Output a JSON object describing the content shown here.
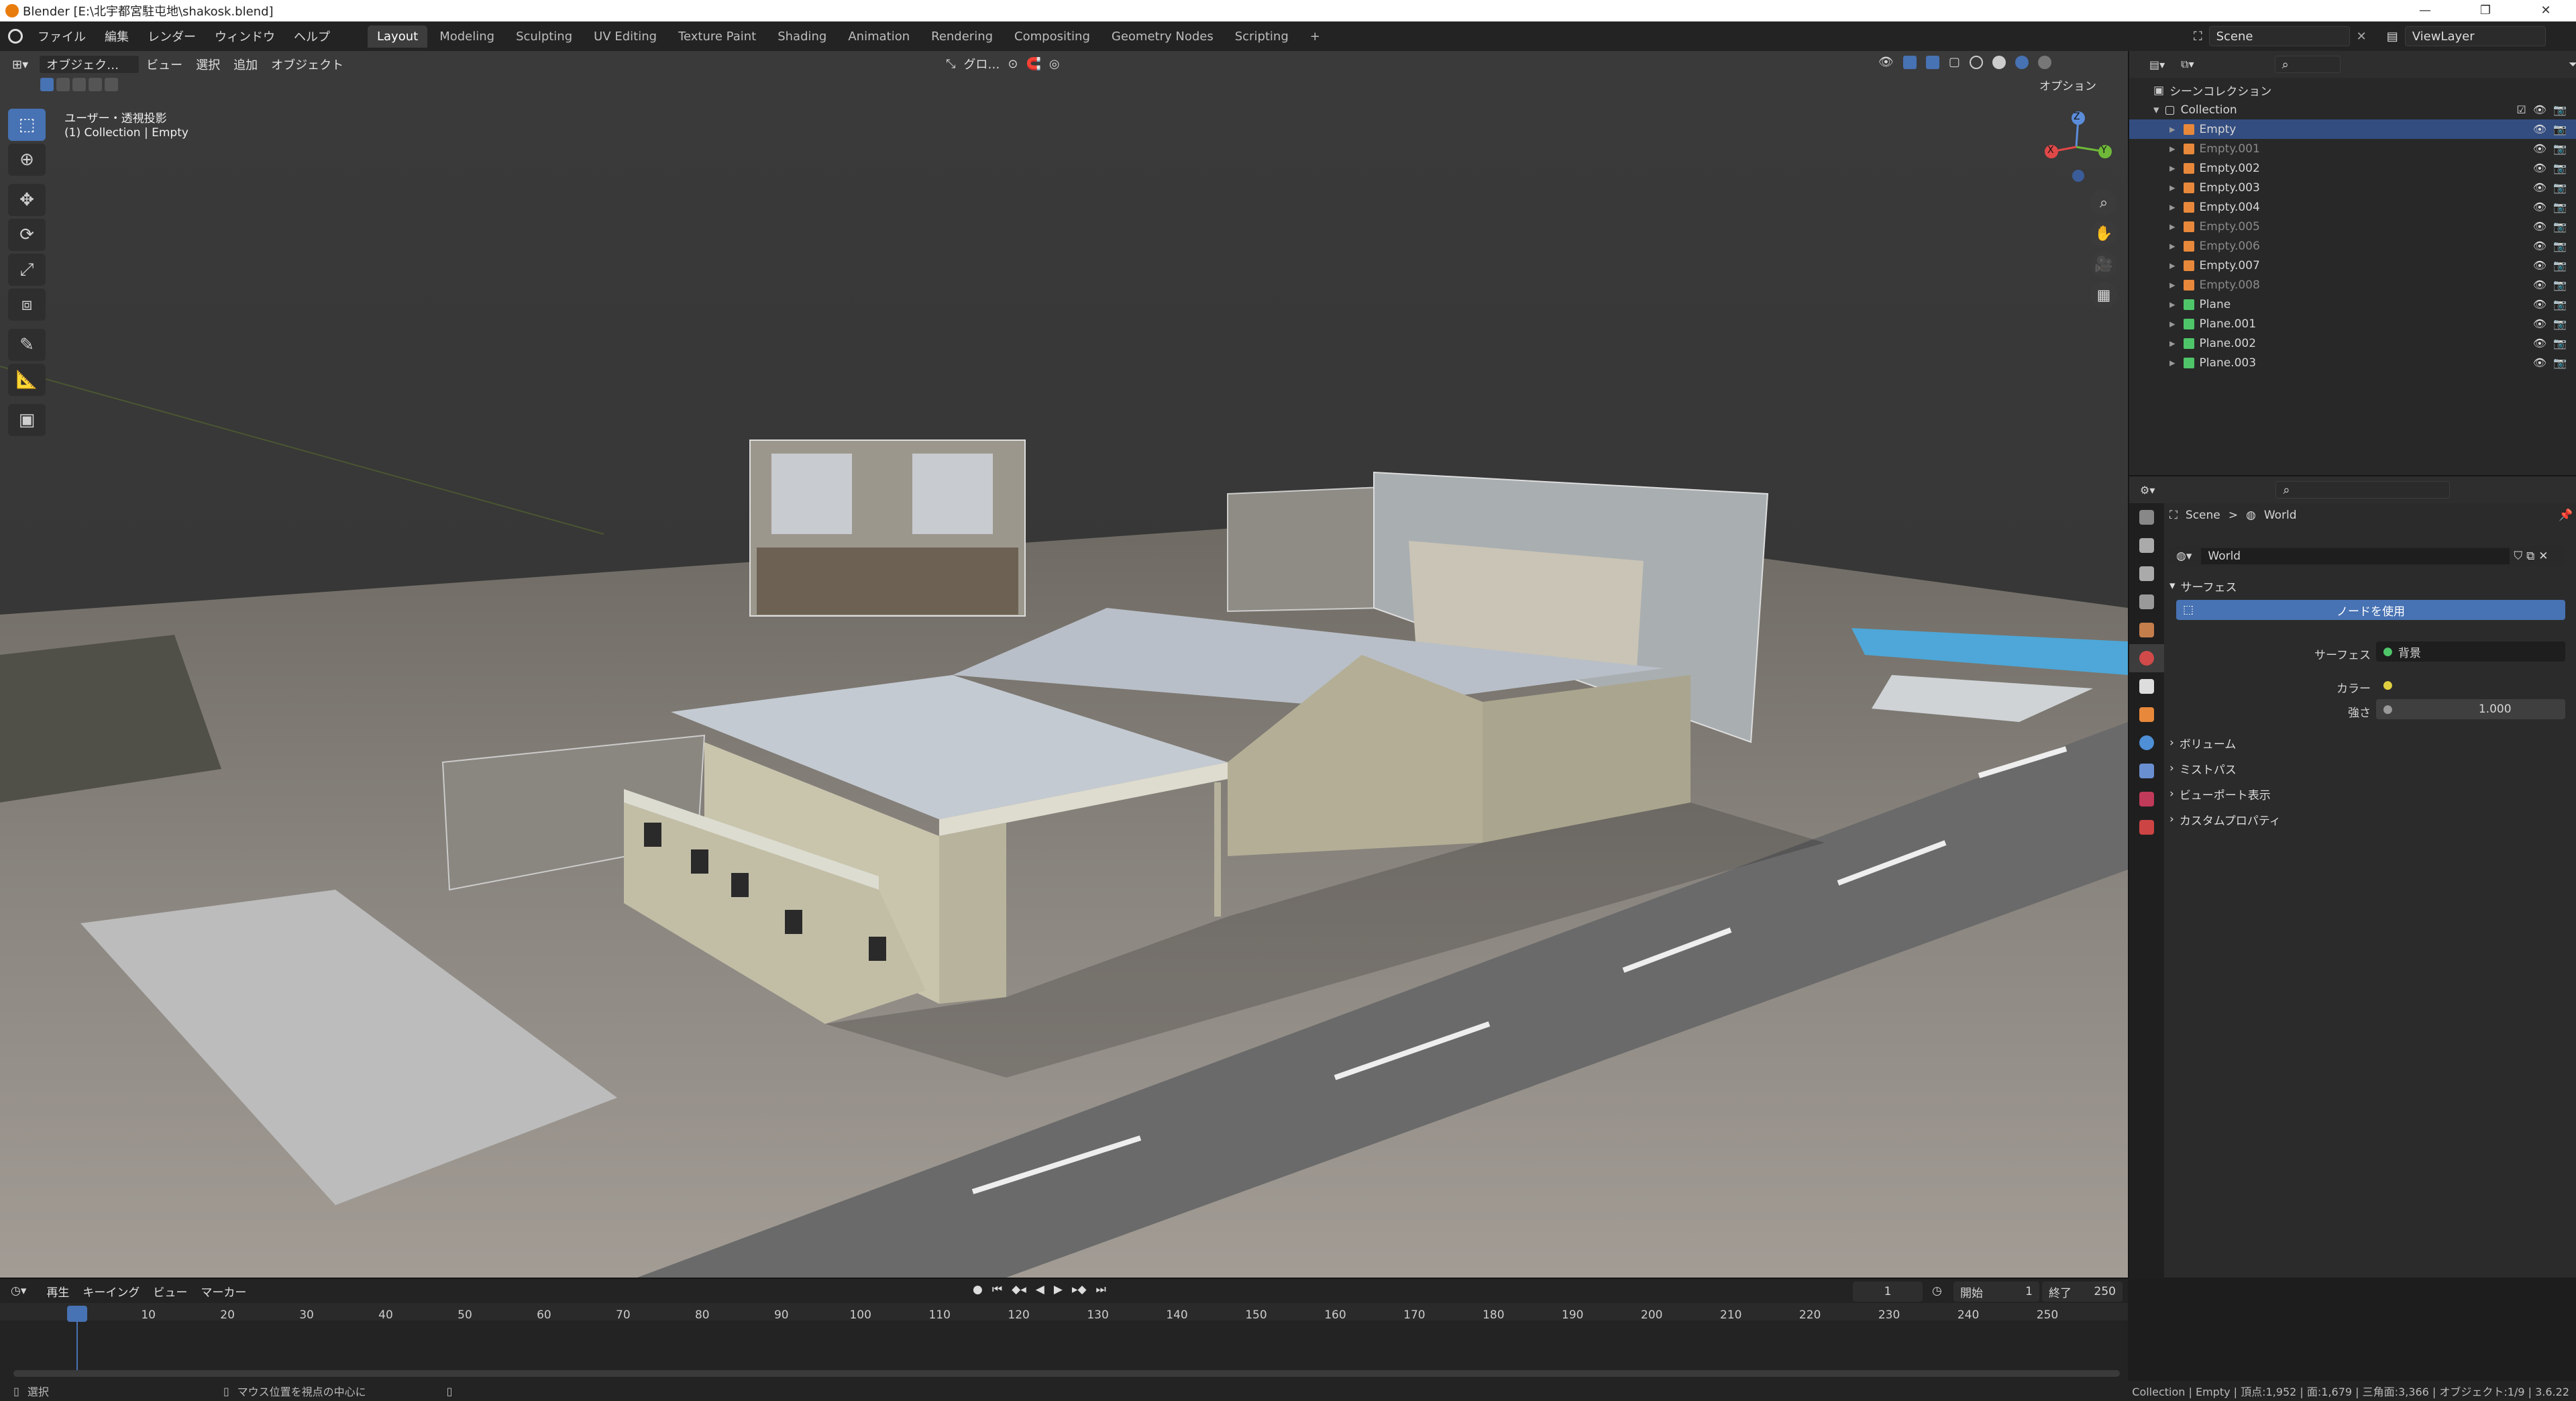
{
  "window": {
    "title": "Blender [E:\\北宇都宮駐屯地\\shakosk.blend]"
  },
  "menus": [
    "ファイル",
    "編集",
    "レンダー",
    "ウィンドウ",
    "ヘルプ"
  ],
  "workspaces": [
    "Layout",
    "Modeling",
    "Sculpting",
    "UV Editing",
    "Texture Paint",
    "Shading",
    "Animation",
    "Rendering",
    "Compositing",
    "Geometry Nodes",
    "Scripting"
  ],
  "workspace_add": "+",
  "scene": {
    "name": "Scene",
    "view_layer": "ViewLayer"
  },
  "viewport": {
    "mode": "オブジェク…",
    "menus": [
      "ビュー",
      "選択",
      "追加",
      "オブジェクト"
    ],
    "orientation": "グロ…",
    "options": "オプション",
    "overlay_line1": "ユーザー・透視投影",
    "overlay_line2": "(1) Collection | Empty",
    "gizmo": {
      "z": "Z",
      "y": "Y",
      "x": "X"
    }
  },
  "outliner": {
    "root": "シーンコレクション",
    "collection": "Collection",
    "items": [
      {
        "name": "Empty",
        "selected": true,
        "dim": false,
        "type": "empty"
      },
      {
        "name": "Empty.001",
        "selected": false,
        "dim": true,
        "type": "empty"
      },
      {
        "name": "Empty.002",
        "selected": false,
        "dim": false,
        "type": "empty"
      },
      {
        "name": "Empty.003",
        "selected": false,
        "dim": false,
        "type": "empty"
      },
      {
        "name": "Empty.004",
        "selected": false,
        "dim": false,
        "type": "empty"
      },
      {
        "name": "Empty.005",
        "selected": false,
        "dim": true,
        "type": "empty"
      },
      {
        "name": "Empty.006",
        "selected": false,
        "dim": true,
        "type": "empty"
      },
      {
        "name": "Empty.007",
        "selected": false,
        "dim": false,
        "type": "empty"
      },
      {
        "name": "Empty.008",
        "selected": false,
        "dim": true,
        "type": "empty"
      },
      {
        "name": "Plane",
        "selected": false,
        "dim": false,
        "type": "mesh"
      },
      {
        "name": "Plane.001",
        "selected": false,
        "dim": false,
        "type": "mesh"
      },
      {
        "name": "Plane.002",
        "selected": false,
        "dim": false,
        "type": "mesh"
      },
      {
        "name": "Plane.003",
        "selected": false,
        "dim": false,
        "type": "mesh"
      }
    ]
  },
  "properties": {
    "breadcrumb_scene": "Scene",
    "breadcrumb_sep": ">",
    "breadcrumb_world": "World",
    "world_name": "World",
    "surface_panel": "サーフェス",
    "use_nodes": "ノードを使用",
    "surface_label": "サーフェス",
    "surface_value": "背景",
    "color_label": "カラー",
    "strength_label": "強さ",
    "strength_value": "1.000",
    "collapsed_panels": [
      "ボリューム",
      "ミストパス",
      "ビューポート表示",
      "カスタムプロパティ"
    ]
  },
  "timeline": {
    "menus": [
      "再生",
      "キーイング",
      "ビュー",
      "マーカー"
    ],
    "current_frame": "1",
    "start_label": "開始",
    "start_value": "1",
    "end_label": "終了",
    "end_value": "250",
    "ticks": [
      "1",
      "10",
      "20",
      "30",
      "40",
      "50",
      "60",
      "70",
      "80",
      "90",
      "100",
      "110",
      "120",
      "130",
      "140",
      "150",
      "160",
      "170",
      "180",
      "190",
      "200",
      "210",
      "220",
      "230",
      "240",
      "250"
    ]
  },
  "statusbar": {
    "left": "選択",
    "middle": "マウス位置を視点の中心に",
    "right": "Collection | Empty | 頂点:1,952 | 面:1,679 | 三角面:3,366 | オブジェクト:1/9 | 3.6.22"
  },
  "colors": {
    "accent": "#4772b3",
    "selected_row": "#334d80",
    "empty_icon": "#e8883a",
    "mesh_icon": "#4fc56a"
  }
}
